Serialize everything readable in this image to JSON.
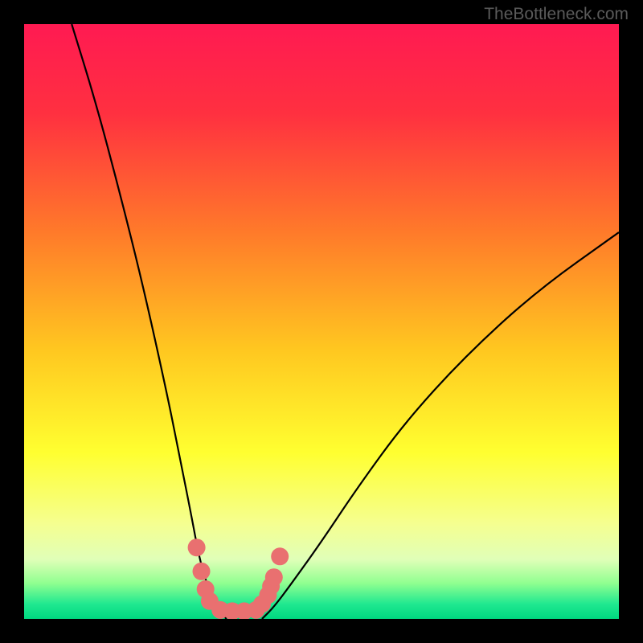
{
  "watermark": "TheBottleneck.com",
  "chart_data": {
    "type": "line",
    "title": "",
    "xlabel": "",
    "ylabel": "",
    "xlim": [
      0,
      100
    ],
    "ylim": [
      0,
      100
    ],
    "gradient": {
      "stops": [
        {
          "pos": 0.0,
          "color": "#ff1a52"
        },
        {
          "pos": 0.15,
          "color": "#ff3040"
        },
        {
          "pos": 0.35,
          "color": "#ff7a2a"
        },
        {
          "pos": 0.55,
          "color": "#ffc820"
        },
        {
          "pos": 0.72,
          "color": "#ffff30"
        },
        {
          "pos": 0.84,
          "color": "#f5ff90"
        },
        {
          "pos": 0.9,
          "color": "#e0ffb8"
        },
        {
          "pos": 0.94,
          "color": "#90ff90"
        },
        {
          "pos": 0.975,
          "color": "#20e890"
        },
        {
          "pos": 1.0,
          "color": "#00d880"
        }
      ]
    },
    "series": [
      {
        "name": "left-curve",
        "x": [
          8,
          12,
          16,
          20,
          24,
          26,
          28,
          29.5,
          31,
          32.5,
          34
        ],
        "y": [
          100,
          87,
          72,
          56,
          38,
          28,
          18,
          10,
          5,
          2,
          0
        ]
      },
      {
        "name": "right-curve",
        "x": [
          40,
          42,
          45,
          50,
          56,
          64,
          74,
          86,
          100
        ],
        "y": [
          0,
          2,
          6,
          13,
          22,
          33,
          44,
          55,
          65
        ]
      }
    ],
    "markers": [
      {
        "x": 29.0,
        "y": 12
      },
      {
        "x": 29.8,
        "y": 8
      },
      {
        "x": 30.5,
        "y": 5
      },
      {
        "x": 31.2,
        "y": 3
      },
      {
        "x": 33.0,
        "y": 1.5
      },
      {
        "x": 35.0,
        "y": 1.3
      },
      {
        "x": 37.0,
        "y": 1.3
      },
      {
        "x": 39.0,
        "y": 1.5
      },
      {
        "x": 40.0,
        "y": 2.5
      },
      {
        "x": 41.0,
        "y": 4.0
      },
      {
        "x": 41.5,
        "y": 5.5
      },
      {
        "x": 42.0,
        "y": 7.0
      },
      {
        "x": 43.0,
        "y": 10.5
      }
    ],
    "marker_color": "#e97070",
    "curve_color": "#000000"
  }
}
